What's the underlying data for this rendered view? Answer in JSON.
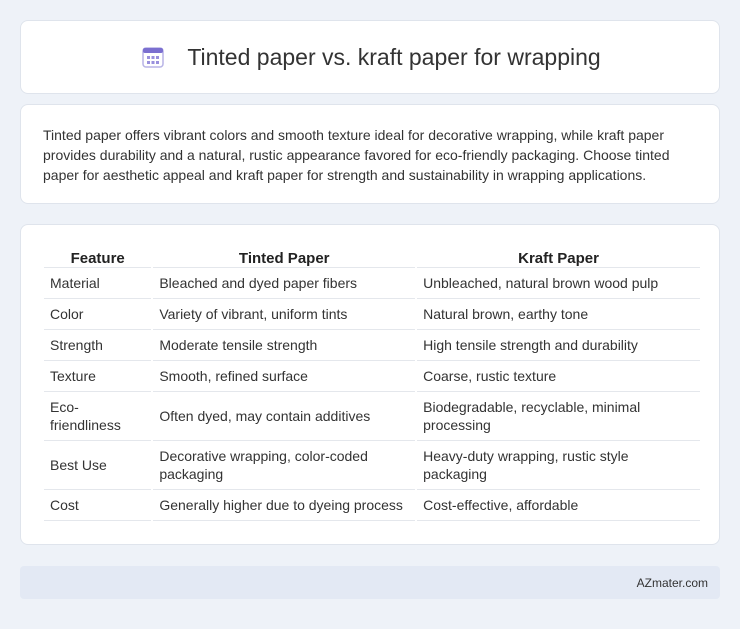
{
  "header": {
    "icon": "calendar-icon",
    "title": "Tinted paper vs. kraft paper for wrapping"
  },
  "intro": {
    "text": "Tinted paper offers vibrant colors and smooth texture ideal for decorative wrapping, while kraft paper provides durability and a natural, rustic appearance favored for eco-friendly packaging. Choose tinted paper for aesthetic appeal and kraft paper for strength and sustainability in wrapping applications."
  },
  "table": {
    "headers": [
      "Feature",
      "Tinted Paper",
      "Kraft Paper"
    ],
    "rows": [
      [
        "Material",
        "Bleached and dyed paper fibers",
        "Unbleached, natural brown wood pulp"
      ],
      [
        "Color",
        "Variety of vibrant, uniform tints",
        "Natural brown, earthy tone"
      ],
      [
        "Strength",
        "Moderate tensile strength",
        "High tensile strength and durability"
      ],
      [
        "Texture",
        "Smooth, refined surface",
        "Coarse, rustic texture"
      ],
      [
        "Eco-friendliness",
        "Often dyed, may contain additives",
        "Biodegradable, recyclable, minimal processing"
      ],
      [
        "Best Use",
        "Decorative wrapping, color-coded packaging",
        "Heavy-duty wrapping, rustic style packaging"
      ],
      [
        "Cost",
        "Generally higher due to dyeing process",
        "Cost-effective, affordable"
      ]
    ]
  },
  "footer": {
    "brand": "AZmater.com"
  },
  "colors": {
    "page_bg": "#eef2f8",
    "card_bg": "#ffffff",
    "footer_bg": "#e3e9f4",
    "icon_accent": "#7b6fd0"
  }
}
